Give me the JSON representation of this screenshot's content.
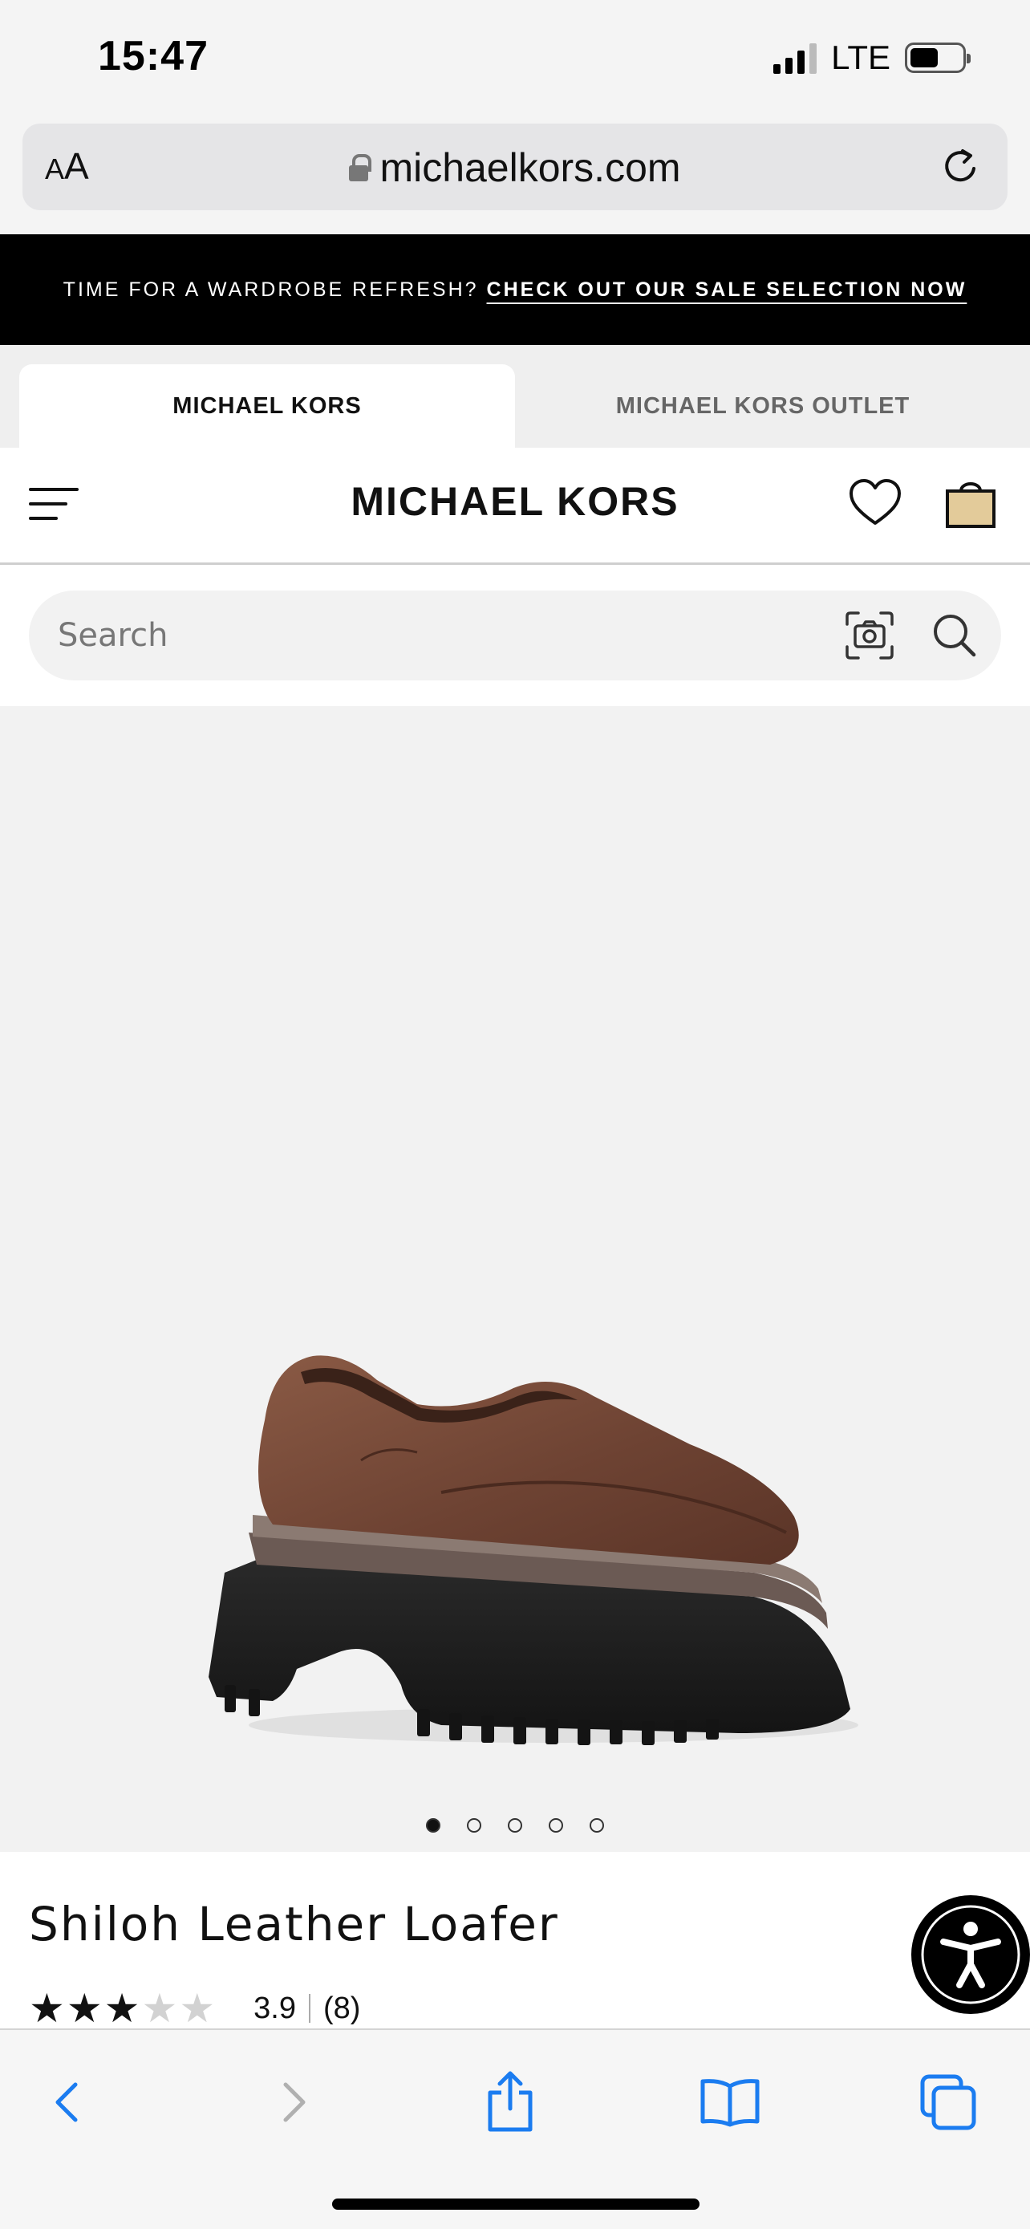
{
  "status_bar": {
    "time": "15:47",
    "network": "LTE",
    "battery_level": 0.55
  },
  "browser": {
    "text_size_small": "A",
    "text_size_large": "A",
    "url": "michaelkors.com",
    "icons": [
      "lock-icon",
      "reload-icon"
    ]
  },
  "promo": {
    "text": "TIME FOR A WARDROBE REFRESH?",
    "link": "CHECK OUT OUR SALE SELECTION NOW"
  },
  "brand_tabs": [
    {
      "label": "MICHAEL KORS",
      "active": true
    },
    {
      "label": "MICHAEL KORS OUTLET",
      "active": false
    }
  ],
  "header": {
    "logo": "MICHAEL KORS",
    "icons": [
      "menu-icon",
      "heart-icon",
      "shopping-bag-icon"
    ]
  },
  "search": {
    "placeholder": "Search",
    "icons": [
      "camera-icon",
      "search-icon"
    ]
  },
  "gallery": {
    "image_count": 5,
    "active_index": 0
  },
  "product": {
    "name": "Shiloh Leather Loafer",
    "rating": "3.9",
    "rating_value": 3.9,
    "rating_max": 5,
    "review_count": "(8)"
  },
  "toolbar": {
    "icons": [
      "back-icon",
      "forward-icon",
      "share-icon",
      "bookmarks-icon",
      "tabs-icon"
    ]
  },
  "colors": {
    "accent_blue": "#1b7cf0",
    "promo_bg": "#000000",
    "bag_fill": "#e3cb9a",
    "shoe_brown": "#7a4a38",
    "sole_black": "#1f1f1f"
  }
}
